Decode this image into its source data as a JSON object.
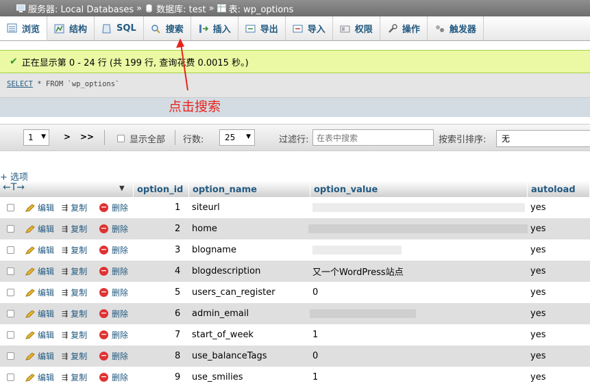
{
  "breadcrumb": {
    "server_label": "服务器: Local Databases",
    "db_label": "数据库: test",
    "table_label": "表: wp_options",
    "separator": "»"
  },
  "tabs": [
    {
      "label": "浏览",
      "icon": "browse-icon",
      "active": true
    },
    {
      "label": "结构",
      "icon": "structure-icon"
    },
    {
      "label": "SQL",
      "icon": "sql-icon"
    },
    {
      "label": "搜索",
      "icon": "search-icon"
    },
    {
      "label": "插入",
      "icon": "insert-icon"
    },
    {
      "label": "导出",
      "icon": "export-icon"
    },
    {
      "label": "导入",
      "icon": "import-icon"
    },
    {
      "label": "权限",
      "icon": "privileges-icon"
    },
    {
      "label": "操作",
      "icon": "operations-icon"
    },
    {
      "label": "触发器",
      "icon": "triggers-icon"
    }
  ],
  "status": {
    "message": "正在显示第 0 - 24 行 (共 199 行, 查询花费 0.0015 秒。)"
  },
  "sql": {
    "keyword": "SELECT",
    "rest": " * FROM `wp_options`"
  },
  "annotation": {
    "text": "点击搜索",
    "color": "#e8231c"
  },
  "nav": {
    "page_value": "1",
    "next_label": ">",
    "last_label": ">>",
    "show_all_label": "显示全部",
    "rows_label": "行数:",
    "rows_value": "25",
    "filter_label": "过滤行:",
    "filter_placeholder": "在表中搜索",
    "sort_label": "按索引排序:",
    "sort_value": "无"
  },
  "options_label": "+ 选项",
  "table": {
    "arrows": "←T→",
    "columns": [
      "option_id",
      "option_name",
      "option_value",
      "autoload"
    ],
    "actions": {
      "edit": "编辑",
      "copy": "复制",
      "delete": "删除"
    },
    "rows": [
      {
        "id": "1",
        "name": "siteurl",
        "value": "",
        "autoload": "yes"
      },
      {
        "id": "2",
        "name": "home",
        "value": "",
        "autoload": "yes"
      },
      {
        "id": "3",
        "name": "blogname",
        "value": "",
        "autoload": "yes"
      },
      {
        "id": "4",
        "name": "blogdescription",
        "value": "又一个WordPress站点",
        "autoload": "yes"
      },
      {
        "id": "5",
        "name": "users_can_register",
        "value": "0",
        "autoload": "yes"
      },
      {
        "id": "6",
        "name": "admin_email",
        "value": "",
        "autoload": "yes"
      },
      {
        "id": "7",
        "name": "start_of_week",
        "value": "1",
        "autoload": "yes"
      },
      {
        "id": "8",
        "name": "use_balanceTags",
        "value": "0",
        "autoload": "yes"
      },
      {
        "id": "9",
        "name": "use_smilies",
        "value": "1",
        "autoload": "yes"
      }
    ]
  },
  "colors": {
    "link": "#235a81",
    "success_bg": "#ebf8a4",
    "annotation": "#e8231c"
  }
}
